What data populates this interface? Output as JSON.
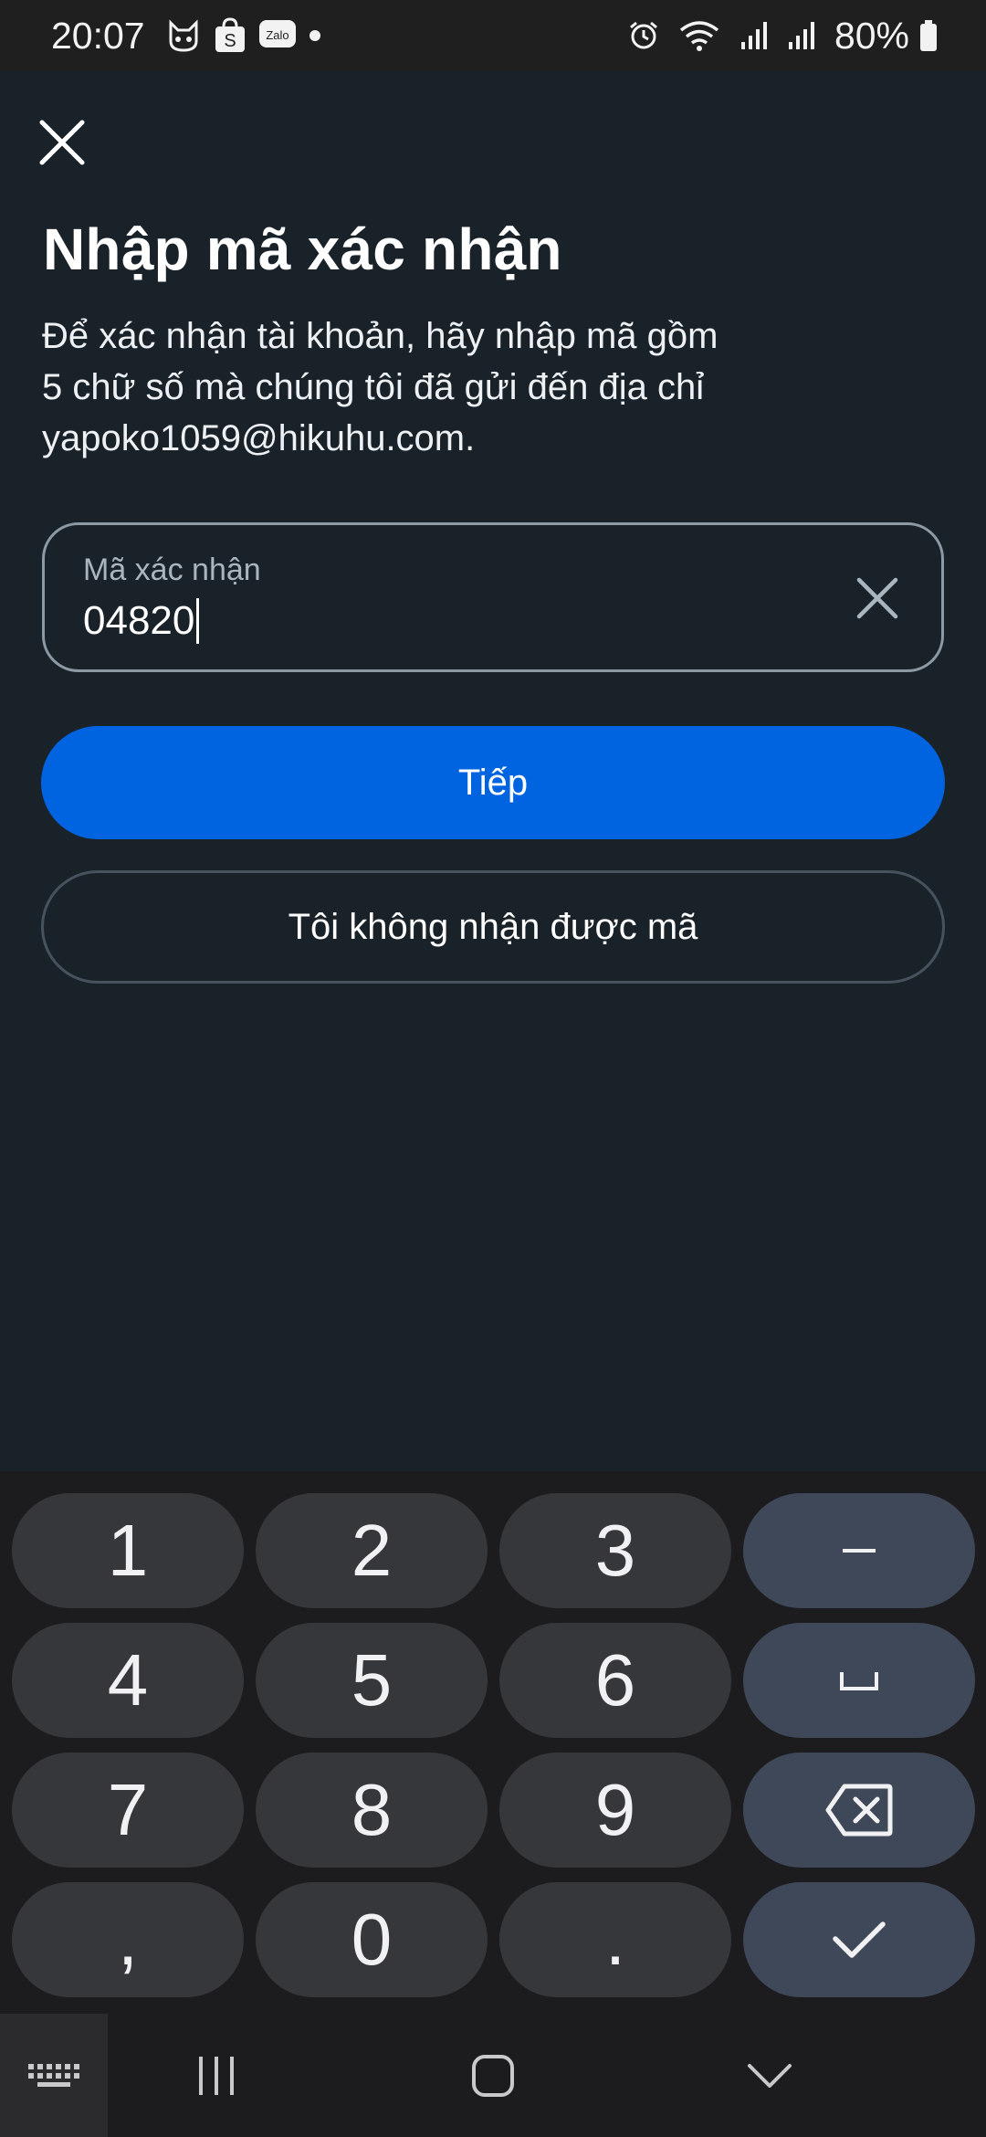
{
  "status_bar": {
    "time": "20:07",
    "left_icons": [
      "cat-face-icon",
      "shopee-icon",
      "zalo-icon",
      "dot-icon"
    ],
    "zalo_text": "Zalo",
    "right_icons": [
      "alarm-icon",
      "wifi-icon",
      "signal-icon",
      "signal-icon",
      "battery-icon"
    ],
    "battery": "80%"
  },
  "screen": {
    "title": "Nhập mã xác nhận",
    "description_lines": [
      "Để xác nhận tài khoản, hãy nhập mã gồm",
      "5 chữ số mà chúng tôi đã gửi đến địa chỉ",
      "yapoko1059@hikuhu.com."
    ],
    "code_field": {
      "label": "Mã xác nhận",
      "value": "04820"
    },
    "next_button": "Tiếp",
    "resend_button": "Tôi không nhận được mã"
  },
  "keyboard": {
    "rows": [
      [
        "1",
        "2",
        "3",
        "–"
      ],
      [
        "4",
        "5",
        "6",
        "␣"
      ],
      [
        "7",
        "8",
        "9",
        "⌫"
      ],
      [
        ",",
        "0",
        ".",
        "✓"
      ]
    ]
  },
  "colors": {
    "background": "#1a2229",
    "primary": "#0064e0",
    "keyboard_key": "#36373b",
    "keyboard_fn_key": "#3f4858"
  }
}
